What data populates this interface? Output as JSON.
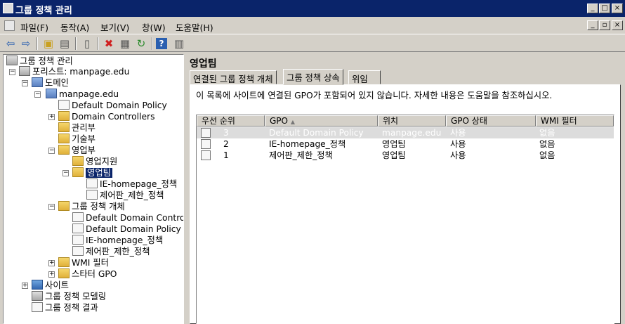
{
  "window": {
    "title": "그룹 정책 관리"
  },
  "menu": {
    "items": [
      "파일(F)",
      "동작(A)",
      "보기(V)",
      "창(W)",
      "도움말(H)"
    ]
  },
  "toolbar": {
    "icons": [
      "back-icon",
      "forward-icon",
      "up-folder-icon",
      "show-tree-icon",
      "properties-icon",
      "delete-icon",
      "export-icon",
      "refresh-icon",
      "help-icon",
      "console-icon"
    ]
  },
  "tree": {
    "root": "그룹 정책 관리",
    "forest": "포리스트: manpage.edu",
    "domains": "도메인",
    "domain": "manpage.edu",
    "ddp": "Default Domain Policy",
    "dc": "Domain Controllers",
    "ou_admin": "관리부",
    "ou_tech": "기술부",
    "ou_sales": "영업부",
    "ou_sales_support": "영업지원",
    "ou_sales_team": "영업팀",
    "link_ie": "IE-homepage_정책",
    "link_cp": "제어판_제한_정책",
    "gpo_container": "그룹 정책 개체",
    "gpo_ddcp": "Default Domain Controlle",
    "gpo_ddp": "Default Domain Policy",
    "gpo_ie": "IE-homepage_정책",
    "gpo_cp": "제어판_제한_정책",
    "wmi": "WMI 필터",
    "starter": "스타터 GPO",
    "sites": "사이트",
    "modeling": "그룹 정책 모델링",
    "results": "그룹 정책 결과"
  },
  "right": {
    "title": "영업팀",
    "tabs": [
      "연결된 그룹 정책 개체",
      "그룹 정책 상속",
      "위임"
    ],
    "info": "이 목록에 사이트에 연결된 GPO가 포함되어 있지 않습니다. 자세한 내용은 도움말을 참조하십시오.",
    "columns": [
      "우선 순위",
      "GPO",
      "위치",
      "GPO 상태",
      "WMI 필터"
    ],
    "rows": [
      {
        "priority": "3",
        "gpo": "Default Domain Policy",
        "location": "manpage.edu",
        "status": "사용",
        "wmi": "없음"
      },
      {
        "priority": "2",
        "gpo": "IE-homepage_정책",
        "location": "영업팀",
        "status": "사용",
        "wmi": "없음"
      },
      {
        "priority": "1",
        "gpo": "제어판_제한_정책",
        "location": "영업팀",
        "status": "사용",
        "wmi": "없음"
      }
    ]
  }
}
